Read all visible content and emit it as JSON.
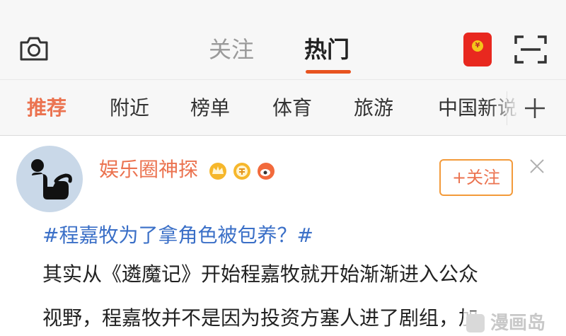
{
  "header": {
    "tabs": [
      {
        "label": "关注",
        "active": false
      },
      {
        "label": "热门",
        "active": true
      }
    ],
    "active_tab_color": "#e8531f",
    "left_icon": "camera-icon",
    "right_icons": [
      "red-packet-icon",
      "scan-icon"
    ]
  },
  "categories": {
    "items": [
      "推荐",
      "附近",
      "榜单",
      "体育",
      "旅游",
      "中国新说"
    ],
    "active": "推荐",
    "active_color": "#eb7350",
    "more_icon": "plus-icon"
  },
  "post": {
    "username": "娱乐圈神探",
    "username_color": "#eb7350",
    "badges": [
      "crown-badge-icon",
      "member-badge-icon",
      "weibo-badge-icon"
    ],
    "follow_label": "+关注",
    "close_icon": "close-icon",
    "hashtag": "#程嘉牧为了拿角色被包养？#",
    "hashtag_color": "#3a6fc7",
    "text_lines": [
      "其实从《遴魔记》开始程嘉牧就开始渐渐进入公众",
      "视野，程嘉牧并不是因为投资方塞人进了剧组，加"
    ]
  },
  "watermark": {
    "text": "漫画岛"
  }
}
